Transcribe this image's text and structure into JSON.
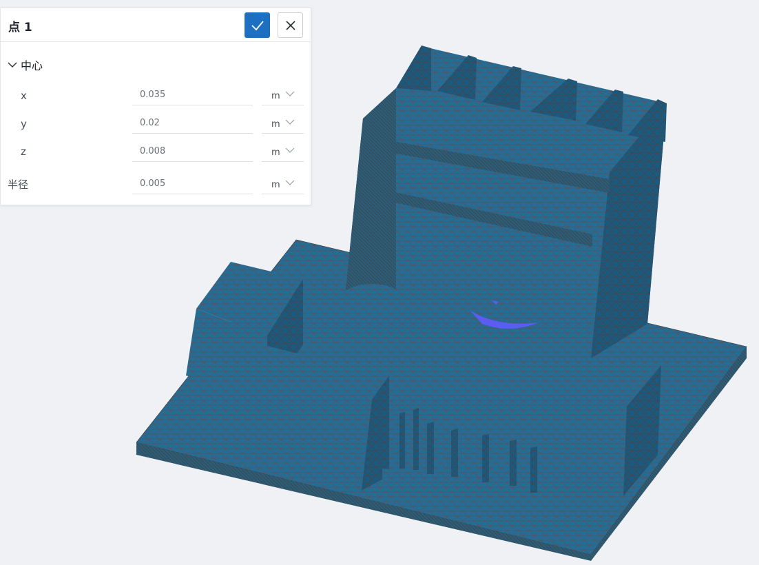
{
  "panel": {
    "title": "点 1",
    "confirm_icon": "check-icon",
    "close_icon": "close-icon",
    "section": {
      "label": "中心",
      "expanded": true,
      "icon": "chevron-down-icon"
    },
    "fields": [
      {
        "label": "x",
        "value": "0.035",
        "unit": "m"
      },
      {
        "label": "y",
        "value": "0.02",
        "unit": "m"
      },
      {
        "label": "z",
        "value": "0.008",
        "unit": "m"
      },
      {
        "label": "半径",
        "value": "0.005",
        "unit": "m"
      }
    ]
  },
  "colors": {
    "accent": "#1d6fc2",
    "mesh_fill": "#1f6f9a",
    "mesh_line": "#6b4a4a",
    "highlight": "#5b5cf2",
    "background": "#f0f1f4"
  }
}
